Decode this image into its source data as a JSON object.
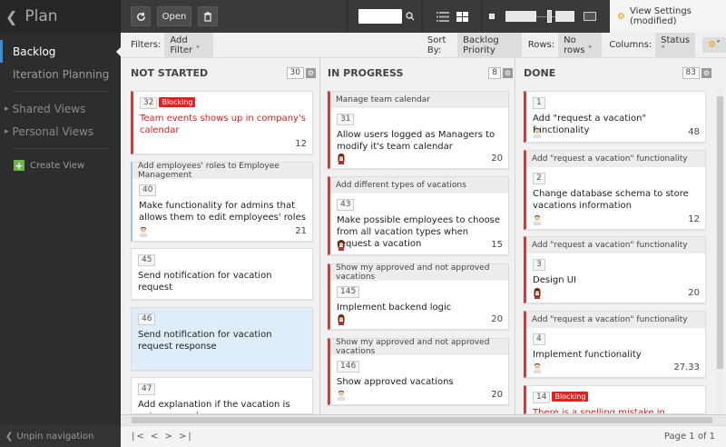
{
  "sidebar": {
    "title": "Plan",
    "items": [
      {
        "label": "Backlog"
      },
      {
        "label": "Iteration Planning"
      }
    ],
    "groups": [
      {
        "label": "Shared Views"
      },
      {
        "label": "Personal Views"
      }
    ],
    "create_view": "Create View",
    "unpin": "Unpin navigation"
  },
  "toolbar": {
    "open_label": "Open",
    "view_settings": "View Settings (modified)"
  },
  "filterbar": {
    "filters_label": "Filters:",
    "add_filter": "Add Filter",
    "sort_label": "Sort By:",
    "sort_value": "Backlog Priority",
    "rows_label": "Rows:",
    "rows_value": "No rows",
    "columns_label": "Columns:",
    "columns_value": "Status"
  },
  "columns": [
    {
      "title": "NOT STARTED",
      "count": "30",
      "cards": [
        {
          "id": "32",
          "blocking": "Blocking",
          "title": "Team events shows up in company's calendar",
          "estimate": "12"
        },
        {
          "parent": "Add employees' roles to Employee Management",
          "id": "40",
          "title": "Make functionality for admins that allows them to edit employees' roles",
          "estimate": "21"
        },
        {
          "id": "45",
          "title": "Send notification for vacation request"
        },
        {
          "id": "46",
          "title": "Send notification for vacation request response"
        },
        {
          "id": "47",
          "title": "Add explanation if the vacation is not approved"
        }
      ]
    },
    {
      "title": "IN PROGRESS",
      "count": "8",
      "cards": [
        {
          "parent": "Manage team calendar",
          "id": "31",
          "title": "Allow users logged as Managers to modify it's team calendar",
          "estimate": "20"
        },
        {
          "parent": "Add different types of vacations",
          "id": "43",
          "title": "Make possible employees to choose from all vacation types when request a vacation",
          "estimate": "15"
        },
        {
          "parent": "Show my approved and not approved vacations",
          "id": "145",
          "title": "Implement backend logic",
          "estimate": "20"
        },
        {
          "parent": "Show my approved and not approved vacations",
          "id": "146",
          "title": "Show approved vacations",
          "estimate": "20"
        }
      ]
    },
    {
      "title": "DONE",
      "count": "83",
      "cards": [
        {
          "id": "1",
          "title": "Add \"request a vacation\" functionality",
          "estimate": "48"
        },
        {
          "parent": "Add \"request a vacation\" functionality",
          "id": "2",
          "title": "Change database schema to store vacations information",
          "estimate": "12"
        },
        {
          "parent": "Add \"request a vacation\" functionality",
          "id": "3",
          "title": "Design UI",
          "estimate": "20"
        },
        {
          "parent": "Add \"request a vacation\" functionality",
          "id": "4",
          "title": "Implement functionality",
          "estimate": "27.33"
        },
        {
          "id": "14",
          "blocking": "Blocking",
          "title": "There is a spelling mistake in vacation"
        }
      ]
    }
  ],
  "pager": {
    "nav": "|< < > >|",
    "page_info": "Page 1 of 1"
  },
  "colors": {
    "accent": "#3a8fd8",
    "blocking": "#e02121",
    "highlight": "#dfecfa"
  }
}
